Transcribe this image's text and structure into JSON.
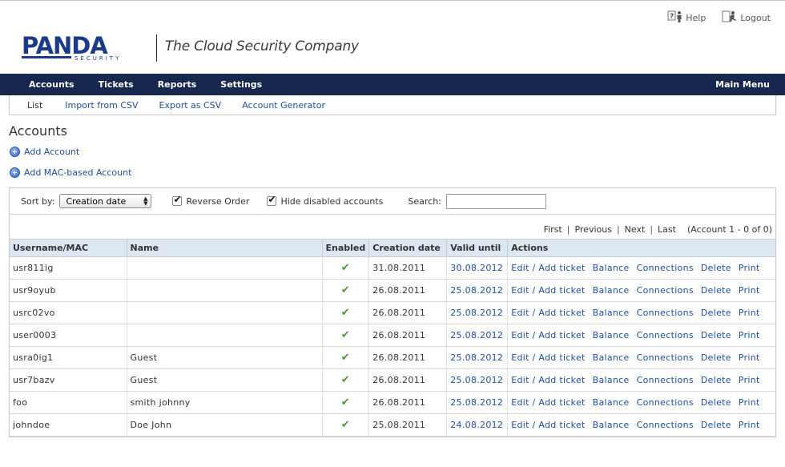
{
  "header": {
    "logo_text": "PANDA",
    "logo_subtext": "SECURITY",
    "tagline": "The Cloud Security Company",
    "help_label": "Help",
    "logout_label": "Logout"
  },
  "nav": {
    "items": [
      {
        "label": "Accounts"
      },
      {
        "label": "Tickets"
      },
      {
        "label": "Reports"
      },
      {
        "label": "Settings"
      }
    ],
    "main_menu_label": "Main Menu"
  },
  "subnav": {
    "items": [
      {
        "label": "List"
      },
      {
        "label": "Import from CSV"
      },
      {
        "label": "Export as CSV"
      },
      {
        "label": "Account Generator"
      }
    ]
  },
  "page": {
    "title": "Accounts",
    "add_account_label": "Add Account",
    "add_mac_account_label": "Add MAC-based Account"
  },
  "filters": {
    "sort_label": "Sort by:",
    "sort_value": "Creation date",
    "reverse_label": "Reverse Order",
    "reverse_checked": true,
    "hide_disabled_label": "Hide disabled accounts",
    "hide_disabled_checked": true,
    "search_label": "Search:",
    "search_value": ""
  },
  "pager": {
    "first": "First",
    "previous": "Previous",
    "next": "Next",
    "last": "Last",
    "info": "(Account 1 - 0 of 0)"
  },
  "table": {
    "columns": [
      "Username/MAC",
      "Name",
      "Enabled",
      "Creation date",
      "Valid until",
      "Actions"
    ],
    "action_labels": {
      "edit": "Edit / Add ticket",
      "balance": "Balance",
      "connections": "Connections",
      "delete": "Delete",
      "print": "Print"
    },
    "rows": [
      {
        "username": "usr811ig",
        "name": "",
        "enabled": true,
        "created": "31.08.2011",
        "valid_until": "30.08.2012"
      },
      {
        "username": "usr9oyub",
        "name": "",
        "enabled": true,
        "created": "26.08.2011",
        "valid_until": "25.08.2012"
      },
      {
        "username": "usrc02vo",
        "name": "",
        "enabled": true,
        "created": "26.08.2011",
        "valid_until": "25.08.2012"
      },
      {
        "username": "user0003",
        "name": "",
        "enabled": true,
        "created": "26.08.2011",
        "valid_until": "25.08.2012"
      },
      {
        "username": "usra0ig1",
        "name": "Guest",
        "enabled": true,
        "created": "26.08.2011",
        "valid_until": "25.08.2012"
      },
      {
        "username": "usr7bazv",
        "name": "Guest",
        "enabled": true,
        "created": "26.08.2011",
        "valid_until": "25.08.2012"
      },
      {
        "username": "foo",
        "name": "smith johnny",
        "enabled": true,
        "created": "26.08.2011",
        "valid_until": "25.08.2012"
      },
      {
        "username": "johndoe",
        "name": "Doe John",
        "enabled": true,
        "created": "25.08.2011",
        "valid_until": "24.08.2012"
      }
    ]
  },
  "icons": {
    "help": "help-icon",
    "logout": "logout-icon",
    "add": "add-circle-icon",
    "enabled": "checkmark-icon"
  },
  "colors": {
    "navbar": "#16284e",
    "link": "#1f4fa0",
    "table_header": "#dde7f2",
    "check": "#4a9b2a",
    "logo_blue": "#1c3a8a"
  }
}
